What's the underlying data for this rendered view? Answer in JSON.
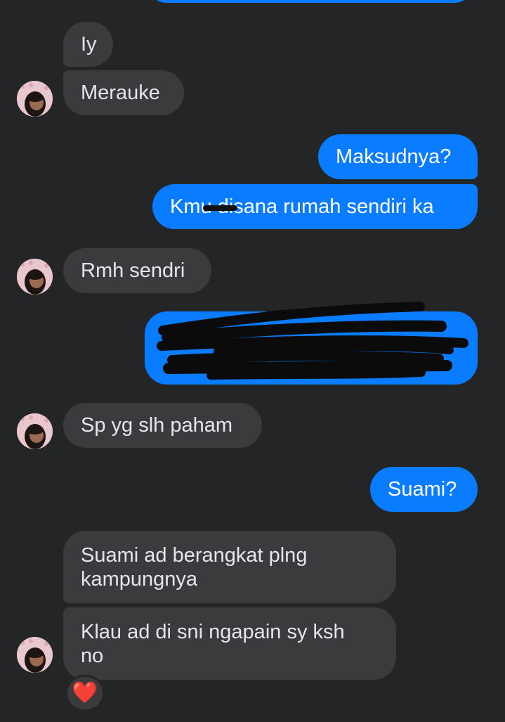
{
  "colors": {
    "background": "#242526",
    "incoming_bubble": "#3a3b3c",
    "outgoing_bubble": "#0a7cff",
    "incoming_text": "#e4e6eb",
    "outgoing_text": "#ffffff"
  },
  "messages": [
    {
      "direction": "in",
      "text": "Iy"
    },
    {
      "direction": "in",
      "text": "Merauke"
    },
    {
      "direction": "out",
      "text": "Maksudnya?"
    },
    {
      "direction": "out",
      "text": "Kmu disana rumah sendiri ka"
    },
    {
      "direction": "in",
      "text": "Rmh sendri"
    },
    {
      "direction": "out",
      "text": "",
      "redacted": true
    },
    {
      "direction": "in",
      "text": "Sp yg slh paham"
    },
    {
      "direction": "out",
      "text": "Suami?"
    },
    {
      "direction": "in",
      "text": "Suami ad berangkat plng"
    },
    {
      "direction": "in",
      "text": "kampungnya"
    },
    {
      "direction": "in",
      "text": "Klau ad di sni ngapain sy ksh"
    },
    {
      "direction": "in",
      "text": "no"
    }
  ],
  "reaction": {
    "icon": "heart-icon",
    "glyph": "❤️"
  },
  "avatar": {
    "icon": "profile-avatar-icon"
  }
}
